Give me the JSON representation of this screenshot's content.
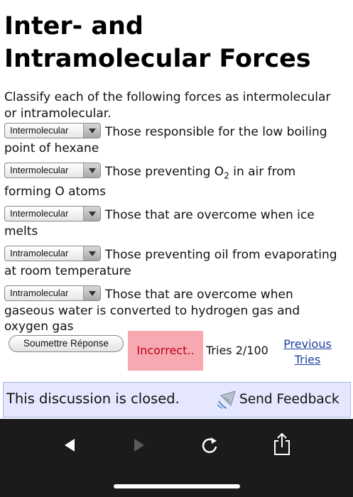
{
  "page": {
    "title_line1": "Inter- and",
    "title_line2": "Intramolecular Forces",
    "instructions_line1": "Classify each of the following forces as intermolecular",
    "instructions_line2": "or intramolecular."
  },
  "items": [
    {
      "selected": "Intermolecular",
      "line1": "Those responsible for the low boiling",
      "line2": "point of hexane"
    },
    {
      "selected": "Intermolecular",
      "line1_pre": "Those preventing O",
      "line1_sub": "2",
      "line1_post": " in air from",
      "line2": "forming O atoms"
    },
    {
      "selected": "Intermolecular",
      "line1": "Those that are overcome when ice",
      "line2": "melts"
    },
    {
      "selected": "Intramolecular",
      "line1": "Those preventing oil from evaporating",
      "line2": "at room temperature"
    },
    {
      "selected": "Intramolecular",
      "line1": "Those that are overcome when",
      "line2": "gaseous water is converted to hydrogen gas and",
      "line3": "oxygen gas"
    }
  ],
  "submit": {
    "button_label": "Soumettre Réponse",
    "result": "Incorrect..",
    "tries": "Tries 2/100",
    "previous_link_line1": "Previous",
    "previous_link_line2": "Tries"
  },
  "discussion": {
    "closed_text": "This discussion is closed.",
    "feedback_label": "Send Feedback"
  },
  "browser": {
    "icons": [
      "back-arrow-icon",
      "forward-arrow-icon",
      "reload-icon",
      "share-icon"
    ]
  },
  "colors": {
    "incorrect_bg": "#f7a9b1",
    "incorrect_text": "#c0001a",
    "link": "#1a3f9c",
    "discussion_bg": "#e4e7fd",
    "browser_bar": "#1b1b1b"
  }
}
